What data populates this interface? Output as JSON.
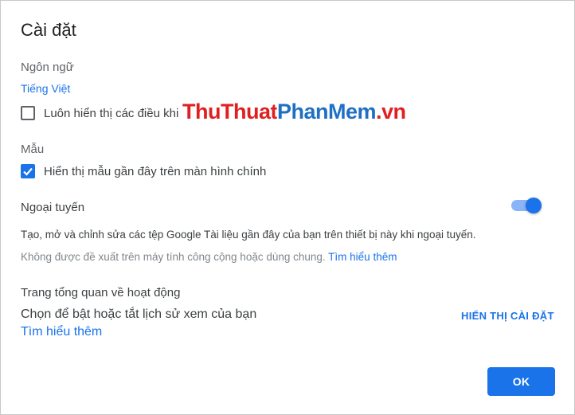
{
  "dialog": {
    "title": "Cài đặt"
  },
  "language": {
    "label": "Ngôn ngữ",
    "current": "Tiếng Việt",
    "checkbox_label": "Luôn hiển thị các điều khi",
    "checkbox_checked": false
  },
  "templates": {
    "label": "Mẫu",
    "checkbox_label": "Hiển thị mẫu gần đây trên màn hình chính",
    "checkbox_checked": true
  },
  "offline": {
    "label": "Ngoại tuyến",
    "enabled": true,
    "description": "Tạo, mở và chỉnh sửa các tệp Google Tài liệu gần đây của bạn trên thiết bị này khi ngoại tuyến.",
    "warning": "Không được đề xuất trên máy tính công cộng hoặc dùng chung.",
    "learn_more": "Tìm hiểu thêm"
  },
  "activity": {
    "label": "Trang tổng quan về hoạt động",
    "text": "Chọn để bật hoặc tắt lịch sử xem của bạn",
    "learn_more": "Tìm hiểu thêm",
    "show_settings": "HIỂN THỊ CÀI ĐẶT"
  },
  "watermark": {
    "part1": "ThuThuat",
    "part2": "PhanMem",
    "part3": ".vn"
  },
  "actions": {
    "ok": "OK"
  },
  "colors": {
    "accent": "#1a73e8",
    "track": "#8ab4f8",
    "text": "#3c4043",
    "muted": "#80868b"
  }
}
